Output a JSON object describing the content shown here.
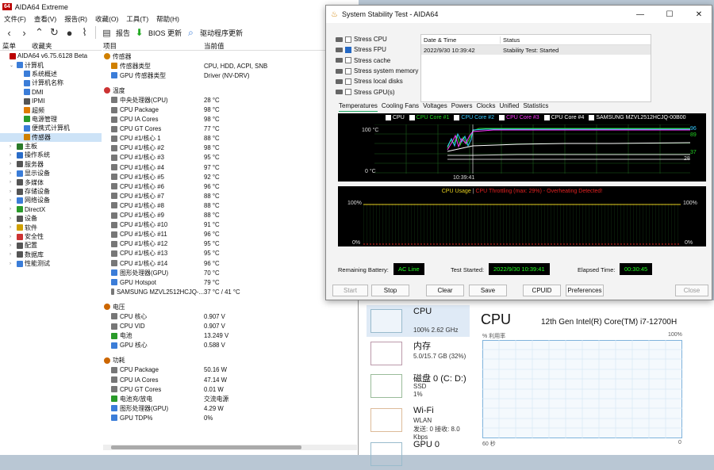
{
  "aida": {
    "title": "AIDA64 Extreme",
    "logo": "64",
    "menu": [
      "文件(F)",
      "查看(V)",
      "报告(R)",
      "收藏(O)",
      "工具(T)",
      "帮助(H)"
    ],
    "toolbar": {
      "report": "报告",
      "bios": "BIOS 更新",
      "driver": "驱动程序更新"
    },
    "left_tabs": [
      "菜单",
      "收藏夹"
    ],
    "tree": [
      {
        "label": "AIDA64 v6.75.6128 Beta",
        "indent": 0,
        "color": "#b00"
      },
      {
        "label": "计算机",
        "indent": 1,
        "color": "#3b7dd8"
      },
      {
        "label": "系统概述",
        "indent": 2,
        "color": "#3b7dd8"
      },
      {
        "label": "计算机名称",
        "indent": 2,
        "color": "#3b7dd8"
      },
      {
        "label": "DMI",
        "indent": 2,
        "color": "#3b7dd8"
      },
      {
        "label": "IPMI",
        "indent": 2,
        "color": "#555"
      },
      {
        "label": "超频",
        "indent": 2,
        "color": "#e07b00"
      },
      {
        "label": "电源管理",
        "indent": 2,
        "color": "#2a9b2a"
      },
      {
        "label": "便携式计算机",
        "indent": 2,
        "color": "#3b7dd8"
      },
      {
        "label": "传感器",
        "indent": 2,
        "color": "#d08000",
        "selected": true
      },
      {
        "label": "主板",
        "indent": 1,
        "color": "#2a7a2a"
      },
      {
        "label": "操作系统",
        "indent": 1,
        "color": "#2a6cc8"
      },
      {
        "label": "服务器",
        "indent": 1,
        "color": "#555"
      },
      {
        "label": "显示设备",
        "indent": 1,
        "color": "#3b7dd8"
      },
      {
        "label": "多媒体",
        "indent": 1,
        "color": "#555"
      },
      {
        "label": "存储设备",
        "indent": 1,
        "color": "#555"
      },
      {
        "label": "网络设备",
        "indent": 1,
        "color": "#3b7dd8"
      },
      {
        "label": "DirectX",
        "indent": 1,
        "color": "#2a9b2a"
      },
      {
        "label": "设备",
        "indent": 1,
        "color": "#555"
      },
      {
        "label": "软件",
        "indent": 1,
        "color": "#d0a000"
      },
      {
        "label": "安全性",
        "indent": 1,
        "color": "#c33"
      },
      {
        "label": "配置",
        "indent": 1,
        "color": "#555"
      },
      {
        "label": "数据库",
        "indent": 1,
        "color": "#555"
      },
      {
        "label": "性能测试",
        "indent": 1,
        "color": "#3b7dd8"
      }
    ],
    "col_item": "项目",
    "col_value": "当前值",
    "rows": [
      {
        "k": "传感器",
        "v": "",
        "sect": true,
        "color": "#d08000"
      },
      {
        "k": "传感器类型",
        "v": "CPU, HDD, ACPI, SNB",
        "color": "#d08000"
      },
      {
        "k": "GPU 传感器类型",
        "v": "Driver  (NV-DRV)",
        "color": "#3b7dd8"
      },
      {
        "k": "",
        "v": "",
        "blank": true
      },
      {
        "k": "温度",
        "v": "",
        "sect": true,
        "color": "#c33"
      },
      {
        "k": "中央处理器(CPU)",
        "v": "28 °C",
        "color": "#777"
      },
      {
        "k": "CPU Package",
        "v": "98 °C",
        "color": "#777"
      },
      {
        "k": "CPU IA Cores",
        "v": "98 °C",
        "color": "#777"
      },
      {
        "k": "CPU GT Cores",
        "v": "77 °C",
        "color": "#777"
      },
      {
        "k": "CPU #1/核心 1",
        "v": "88 °C",
        "color": "#777"
      },
      {
        "k": "CPU #1/核心 #2",
        "v": "98 °C",
        "color": "#777"
      },
      {
        "k": "CPU #1/核心 #3",
        "v": "95 °C",
        "color": "#777"
      },
      {
        "k": "CPU #1/核心 #4",
        "v": "97 °C",
        "color": "#777"
      },
      {
        "k": "CPU #1/核心 #5",
        "v": "92 °C",
        "color": "#777"
      },
      {
        "k": "CPU #1/核心 #6",
        "v": "96 °C",
        "color": "#777"
      },
      {
        "k": "CPU #1/核心 #7",
        "v": "88 °C",
        "color": "#777"
      },
      {
        "k": "CPU #1/核心 #8",
        "v": "88 °C",
        "color": "#777"
      },
      {
        "k": "CPU #1/核心 #9",
        "v": "88 °C",
        "color": "#777"
      },
      {
        "k": "CPU #1/核心 #10",
        "v": "91 °C",
        "color": "#777"
      },
      {
        "k": "CPU #1/核心 #11",
        "v": "96 °C",
        "color": "#777"
      },
      {
        "k": "CPU #1/核心 #12",
        "v": "95 °C",
        "color": "#777"
      },
      {
        "k": "CPU #1/核心 #13",
        "v": "95 °C",
        "color": "#777"
      },
      {
        "k": "CPU #1/核心 #14",
        "v": "96 °C",
        "color": "#777"
      },
      {
        "k": "图形处理器(GPU)",
        "v": "70 °C",
        "color": "#3b7dd8"
      },
      {
        "k": "GPU Hotspot",
        "v": "79 °C",
        "color": "#3b7dd8"
      },
      {
        "k": "SAMSUNG MZVL2512HCJQ-...",
        "v": "37 °C / 41 °C",
        "color": "#777"
      },
      {
        "k": "",
        "v": "",
        "blank": true
      },
      {
        "k": "电压",
        "v": "",
        "sect": true,
        "color": "#c60"
      },
      {
        "k": "CPU 核心",
        "v": "0.907 V",
        "color": "#777"
      },
      {
        "k": "CPU VID",
        "v": "0.907 V",
        "color": "#777"
      },
      {
        "k": "电池",
        "v": "13.249 V",
        "color": "#2a9b2a"
      },
      {
        "k": "GPU 核心",
        "v": "0.588 V",
        "color": "#3b7dd8"
      },
      {
        "k": "",
        "v": "",
        "blank": true
      },
      {
        "k": "功耗",
        "v": "",
        "sect": true,
        "color": "#c60"
      },
      {
        "k": "CPU Package",
        "v": "50.16 W",
        "color": "#777"
      },
      {
        "k": "CPU IA Cores",
        "v": "47.14 W",
        "color": "#777"
      },
      {
        "k": "CPU GT Cores",
        "v": "0.01 W",
        "color": "#777"
      },
      {
        "k": "电池充/放电",
        "v": "交流电源",
        "color": "#2a9b2a"
      },
      {
        "k": "图形处理器(GPU)",
        "v": "4.29 W",
        "color": "#3b7dd8"
      },
      {
        "k": "GPU TDP%",
        "v": "0%",
        "color": "#3b7dd8"
      }
    ]
  },
  "sst": {
    "title": "System Stability Test - AIDA64",
    "options": [
      {
        "label": "Stress CPU",
        "checked": false
      },
      {
        "label": "Stress FPU",
        "checked": true
      },
      {
        "label": "Stress cache",
        "checked": false
      },
      {
        "label": "Stress system memory",
        "checked": false
      },
      {
        "label": "Stress local disks",
        "checked": false
      },
      {
        "label": "Stress GPU(s)",
        "checked": false
      }
    ],
    "table": {
      "h1": "Date & Time",
      "h2": "Status",
      "d1": "2022/9/30 10:39:42",
      "d2": "Stability Test: Started"
    },
    "tabs": [
      "Temperatures",
      "Cooling Fans",
      "Voltages",
      "Powers",
      "Clocks",
      "Unified",
      "Statistics"
    ],
    "legend": [
      {
        "label": "CPU",
        "color": "#ffffff"
      },
      {
        "label": "CPU Core #1",
        "color": "#22d422"
      },
      {
        "label": "CPU Core #2",
        "color": "#33c8ff"
      },
      {
        "label": "CPU Core #3",
        "color": "#ff33ff"
      },
      {
        "label": "CPU Core #4",
        "color": "#ffffff"
      },
      {
        "label": "SAMSUNG MZVL2512HCJQ-00B00",
        "color": "#ffffff"
      }
    ],
    "g1": {
      "ymax": "100 °C",
      "ymin": "0 °C",
      "time": "10:39:41",
      "r1": "96",
      "r2": "89",
      "r3": "37",
      "r4": "28"
    },
    "g2": {
      "title_a": "CPU Usage",
      "title_b": "CPU Throttling (max: 29%) - Overheating Detected!",
      "left_top": "100%",
      "left_bot": "0%",
      "right_top": "100%",
      "right_bot": "0%"
    },
    "status": {
      "battery_label": "Remaining Battery:",
      "battery": "AC Line",
      "started_label": "Test Started:",
      "started": "2022/9/30 10:39:41",
      "elapsed_label": "Elapsed Time:",
      "elapsed": "00:30:45"
    },
    "buttons": {
      "start": "Start",
      "stop": "Stop",
      "clear": "Clear",
      "save": "Save",
      "cpuid": "CPUID",
      "prefs": "Preferences",
      "close": "Close"
    }
  },
  "tm": {
    "items": [
      {
        "title": "CPU",
        "sub1": "100%  2.62 GHz",
        "sub2": ""
      },
      {
        "title": "内存",
        "sub1": "5.0/15.7 GB (32%)",
        "sub2": ""
      },
      {
        "title": "磁盘 0 (C: D:)",
        "sub1": "SSD",
        "sub2": "1%"
      },
      {
        "title": "Wi-Fi",
        "sub1": "WLAN",
        "sub2": "发送: 0  接收: 8.0 Kbps"
      },
      {
        "title": "GPU 0",
        "sub1": "",
        "sub2": ""
      }
    ],
    "cpu_title": "CPU",
    "cpu_model": "12th Gen Intel(R) Core(TM) i7-12700H",
    "util_label": "% 利用率",
    "util_max": "100%",
    "time_left": "60 秒",
    "time_right": "0"
  }
}
